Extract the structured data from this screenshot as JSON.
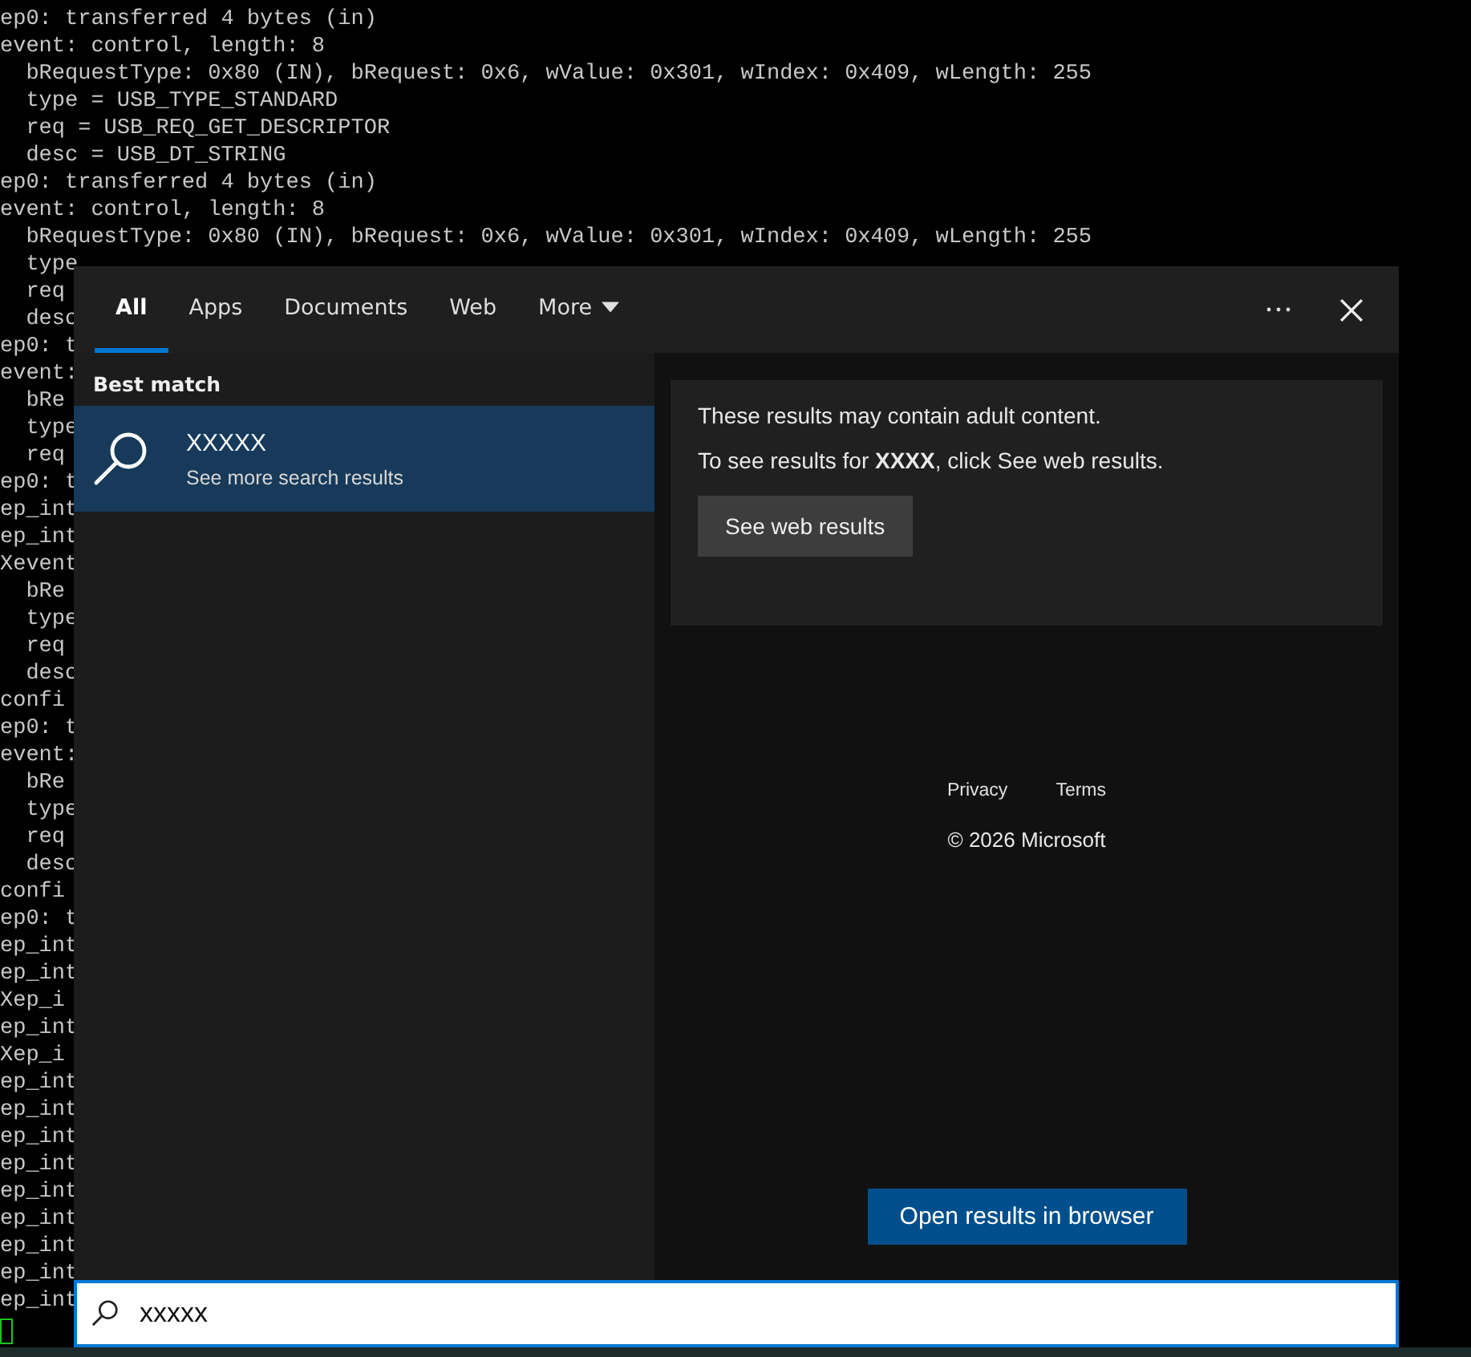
{
  "terminal": {
    "lines": [
      "ep0: transferred 4 bytes (in)",
      "event: control, length: 8",
      "  bRequestType: 0x80 (IN), bRequest: 0x6, wValue: 0x301, wIndex: 0x409, wLength: 255",
      "  type = USB_TYPE_STANDARD",
      "  req = USB_REQ_GET_DESCRIPTOR",
      "  desc = USB_DT_STRING",
      "ep0: transferred 4 bytes (in)",
      "event: control, length: 8",
      "  bRequestType: 0x80 (IN), bRequest: 0x6, wValue: 0x301, wIndex: 0x409, wLength: 255"
    ],
    "clipped_lines": [
      "  type",
      "  req",
      "  desc",
      "ep0: t",
      "event:",
      "  bRe",
      "  type",
      "  req",
      "ep0: t",
      "ep_int",
      "ep_int",
      "Xevent",
      "  bRe",
      "  type",
      "  req",
      "  desc",
      "confi",
      "ep0: t",
      "event:",
      "  bRe",
      "  type",
      "  req",
      "  desc",
      "confi",
      "ep0: t",
      "ep_int",
      "ep_int",
      "Xep_i",
      "ep_int",
      "Xep_i",
      "ep_int",
      "ep_int",
      "ep_int",
      "ep_int",
      "ep_int",
      "ep_int",
      "ep_int",
      "ep_int",
      "ep_int"
    ]
  },
  "search_panel": {
    "tabs": [
      {
        "label": "All",
        "selected": true,
        "dropdown": false
      },
      {
        "label": "Apps",
        "selected": false,
        "dropdown": false
      },
      {
        "label": "Documents",
        "selected": false,
        "dropdown": false
      },
      {
        "label": "Web",
        "selected": false,
        "dropdown": false
      },
      {
        "label": "More",
        "selected": false,
        "dropdown": true
      }
    ],
    "section_heading": "Best match",
    "results": [
      {
        "title": "XXXXX",
        "subtitle": "See more search results",
        "selected": true
      }
    ],
    "notice": {
      "heading": "These results may contain adult content.",
      "body": "To see results for **XXXX**, click See web results.",
      "button": "See web results"
    },
    "footer_links": [
      "Privacy",
      "Terms"
    ],
    "copyright": "© 2026 Microsoft",
    "open_button": "Open results in browser",
    "search": {
      "value": "xxxxx"
    }
  }
}
